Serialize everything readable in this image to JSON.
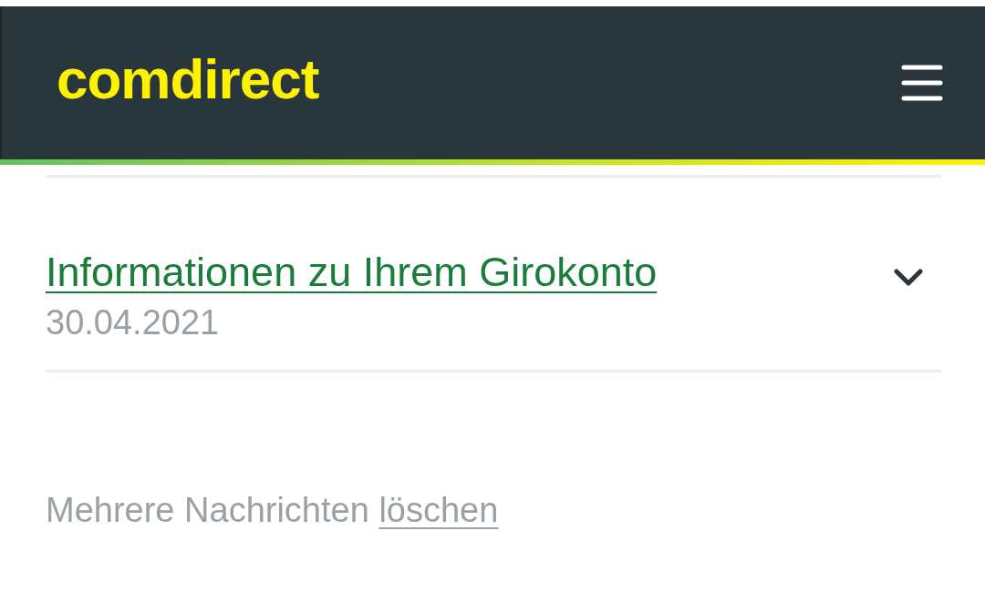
{
  "header": {
    "logo": "comdirect"
  },
  "messages": [
    {
      "title": "Informationen zu Ihrem Girokonto",
      "date": "30.04.2021",
      "expanded": false
    }
  ],
  "footer": {
    "text": "Mehrere Nachrichten",
    "link": "löschen"
  }
}
